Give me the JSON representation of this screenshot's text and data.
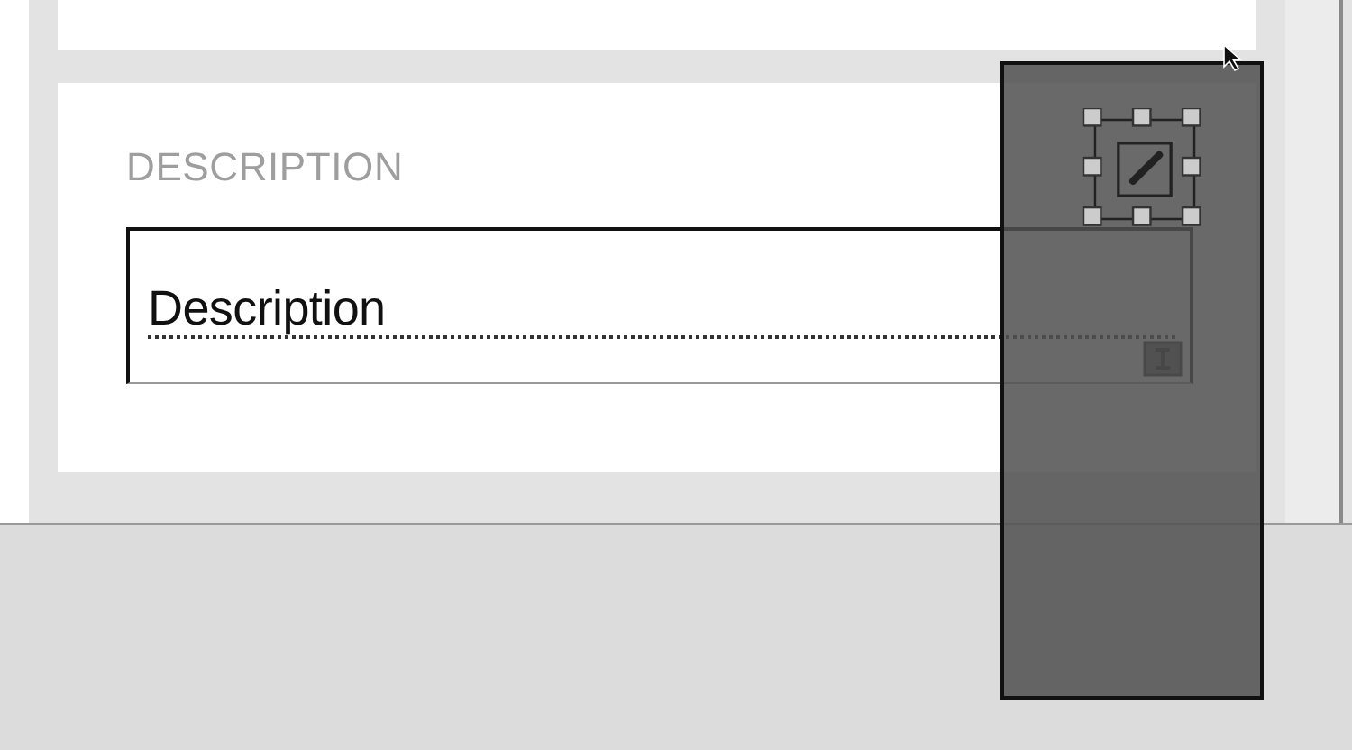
{
  "section": {
    "label": "DESCRIPTION",
    "field": {
      "value": "Description"
    }
  }
}
